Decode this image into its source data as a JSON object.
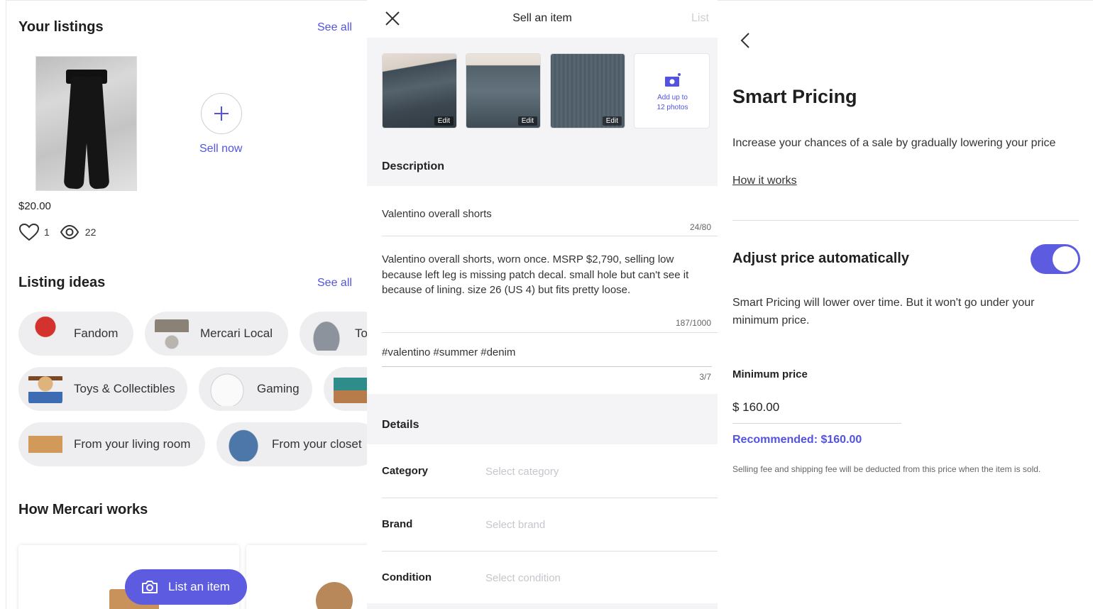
{
  "listings": {
    "title": "Your listings",
    "see_all": "See all",
    "item": {
      "price": "$20.00",
      "likes": "1",
      "views": "22"
    },
    "sell_now": "Sell now"
  },
  "ideas": {
    "title": "Listing ideas",
    "see_all": "See all",
    "chips": [
      {
        "label": "Fandom"
      },
      {
        "label": "Mercari Local"
      },
      {
        "label": "To"
      },
      {
        "label": "Toys & Collectibles"
      },
      {
        "label": "Gaming"
      },
      {
        "label": ""
      },
      {
        "label": "From your living room"
      },
      {
        "label": "From your closet"
      }
    ]
  },
  "how": {
    "title": "How Mercari works"
  },
  "fab": {
    "label": "List an item"
  },
  "sell": {
    "title": "Sell an item",
    "list": "List",
    "edit": "Edit",
    "add_photos_line1": "Add up to",
    "add_photos_line2": "12 photos",
    "description_header": "Description",
    "item_title": "Valentino overall shorts",
    "title_count": "24/80",
    "description": "Valentino overall shorts, worn once. MSRP $2,790, selling low because left leg is missing patch decal. small hole but can't see it because of lining. size 26 (US 4) but fits pretty loose.",
    "description_count": "187/1000",
    "tags": "#valentino #summer #denim",
    "tags_count": "3/7",
    "details_header": "Details",
    "rows": [
      {
        "label": "Category",
        "placeholder": "Select category"
      },
      {
        "label": "Brand",
        "placeholder": "Select brand"
      },
      {
        "label": "Condition",
        "placeholder": "Select condition"
      }
    ]
  },
  "smart": {
    "title": "Smart Pricing",
    "intro": "Increase your chances of a sale by gradually lowering your price",
    "how_it_works": "How it works",
    "adjust_label": "Adjust price automatically",
    "adjust_on": true,
    "explain": "Smart Pricing will lower over time. But it won't go under your minimum price.",
    "min_label": "Minimum price",
    "min_value": "$ 160.00",
    "recommended": "Recommended: $160.00",
    "fee_note": "Selling fee and shipping fee will be deducted from this price when the item is sold."
  },
  "colors": {
    "accent": "#5d5ce0",
    "link": "#5353e0",
    "grey_bg": "#f4f4f6"
  },
  "icons": [
    "heart-icon",
    "eye-icon",
    "plus-icon",
    "close-icon",
    "camera-icon",
    "back-chevron-icon"
  ]
}
